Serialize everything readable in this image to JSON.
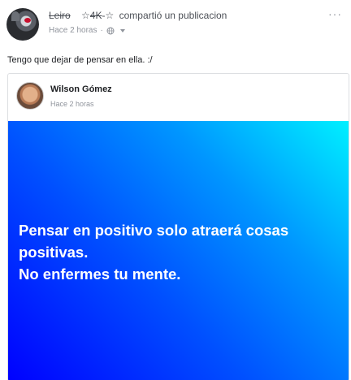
{
  "post": {
    "author": "Leiro",
    "badge": "4K",
    "badge_stars": [
      "☆",
      "☆"
    ],
    "shared_text": "compartió un publicacion",
    "timestamp": "Hace 2 horas",
    "privacy_icon": "globe-icon",
    "more_icon": "ellipsis-icon",
    "text": "Tengo que dejar de pensar en ella. :/"
  },
  "shared_post": {
    "author": "Wilson Gómez",
    "timestamp": "Hace 2 horas",
    "message_lines": [
      "Pensar en positivo solo atraerá cosas",
      "positivas.",
      "No enfermes tu mente."
    ],
    "gradient_colors": [
      "#00f0ff",
      "#0096ff",
      "#0050ff",
      "#0000ff"
    ]
  },
  "colors": {
    "meta_text": "#90949c",
    "border": "#dddfe2"
  }
}
